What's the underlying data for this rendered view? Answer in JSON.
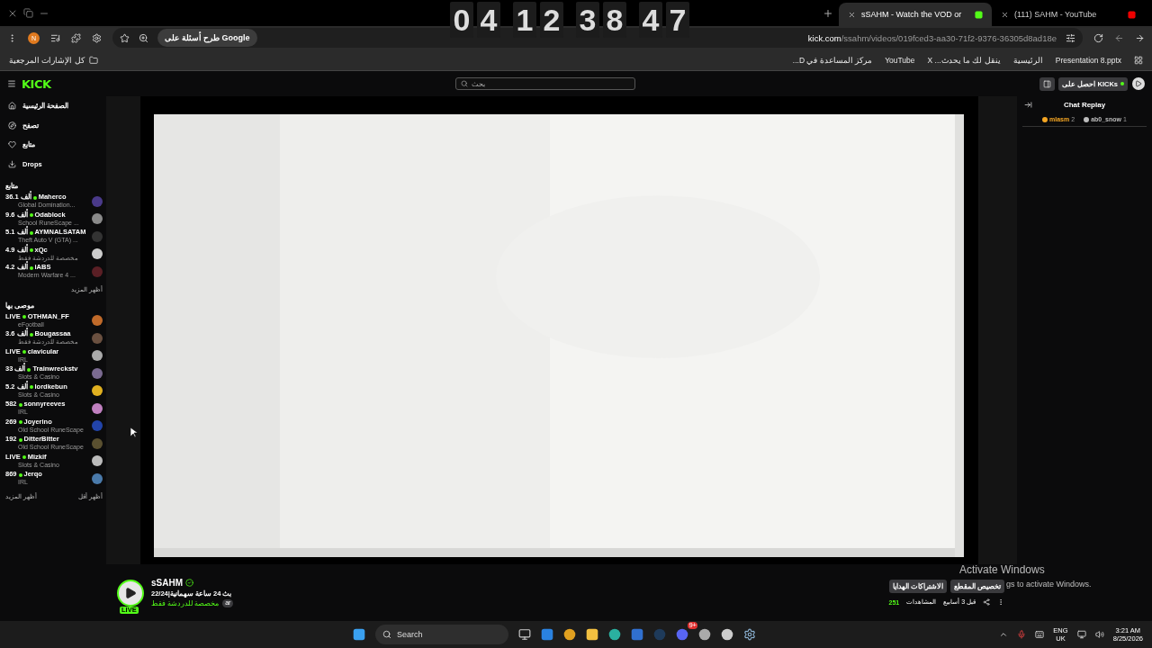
{
  "browser": {
    "tabs": [
      {
        "title": "(111) SAHM - YouTube",
        "selected": false
      },
      {
        "title": "sSAHM - Watch the VOD or",
        "selected": true
      }
    ],
    "profile_initial": "N",
    "google_chip": "طرح أسئلة على Google",
    "url": {
      "host": "kick.com",
      "path": "/ssahm/videos/019fced3-aa30-71f2-9376-36305d8ad18e"
    },
    "all_bookmarks": "كل الإشارات المرجعية",
    "bookmarks": [
      {
        "label": "Presentation 8.pptx"
      },
      {
        "label": "الرئيسية"
      },
      {
        "label": "ينقل لك ما يحدث... X"
      },
      {
        "label": "YouTube"
      },
      {
        "label": "مركز المساعدة في D..."
      }
    ]
  },
  "clock": {
    "digits": [
      "7",
      "4",
      "8",
      "3",
      "2",
      "1",
      "4",
      "0"
    ]
  },
  "site": {
    "logo": "KICK",
    "search": {
      "placeholder": "بحث"
    },
    "kicks_button": "احصل على KICKs"
  },
  "sidebar": {
    "nav": [
      {
        "label": "الصفحة الرئيسية"
      },
      {
        "label": "تصفح"
      },
      {
        "label": "متابع"
      },
      {
        "label": "Drops"
      }
    ],
    "sections": [
      {
        "title": "متابع",
        "channels": [
          {
            "name": "Maherco",
            "viewers": "36.1 ألف",
            "category": "Global Domination..."
          },
          {
            "name": "Odablock",
            "viewers": "9.6 ألف",
            "category": "School RuneScape ..."
          },
          {
            "name": "AYMNALSATAM",
            "viewers": "5.1 ألف",
            "category": "Theft Auto V (GTA) ..."
          },
          {
            "name": "xQc",
            "viewers": "4.9 ألف",
            "category": "مخصصة للدردشة فقط"
          },
          {
            "name": "iABS",
            "viewers": "4.2 ألف",
            "category": "Modern Warfare 4 ..."
          }
        ],
        "links": [
          "أظهر المزيد"
        ]
      },
      {
        "title": "موصى بها",
        "channels": [
          {
            "name": "OTHMAN_FF",
            "viewers": "LIVE",
            "category": "eFootball"
          },
          {
            "name": "Bougassaa",
            "viewers": "3.6 ألف",
            "category": "مخصصة للدردشة فقط"
          },
          {
            "name": "clavicular",
            "viewers": "LIVE",
            "category": "IRL"
          },
          {
            "name": "Trainwreckstv",
            "viewers": "33 ألف",
            "category": "Slots & Casino"
          },
          {
            "name": "lordkebun",
            "viewers": "5.2 ألف",
            "category": "Slots & Casino"
          },
          {
            "name": "sonnyreeves",
            "viewers": "582",
            "category": "IRL"
          },
          {
            "name": "Joyerino",
            "viewers": "269",
            "category": "Old School RuneScape"
          },
          {
            "name": "DitterBitter",
            "viewers": "192",
            "category": "Old School RuneScape"
          },
          {
            "name": "Mizkif",
            "viewers": "LIVE",
            "category": "Slots & Casino"
          },
          {
            "name": "Jerqo",
            "viewers": "869",
            "category": "IRL"
          }
        ],
        "links": [
          "أظهر أقل",
          "أظهر المزيد"
        ]
      }
    ]
  },
  "channel": {
    "name": "sSAHM",
    "verified": true,
    "badge": "LIVE",
    "title": "بث 24 ساعة سهمانية|22/24",
    "category": "مخصصة للدردشة فقط",
    "tag": "ar",
    "buttons": [
      "تخصيص المقطع",
      "الاشتراكات الهدايا"
    ],
    "age": "قبل 3 أسابيع",
    "views_label": "المشاهدات",
    "views": "251"
  },
  "chat": {
    "title": "Chat Replay",
    "leaders": [
      {
        "name": "ab0_snow",
        "count": "1",
        "color": "#bdbdbd"
      },
      {
        "name": "mlasm",
        "count": "2",
        "color": "#f5a623"
      }
    ]
  },
  "activation": {
    "title": "Activate Windows",
    "subtitle": "gs to activate Windows."
  },
  "taskbar": {
    "search": "Search",
    "language": "ENG",
    "region": "UK",
    "time": "3:21 AM",
    "date": "8/25/2026",
    "notification_badge": "9+"
  }
}
